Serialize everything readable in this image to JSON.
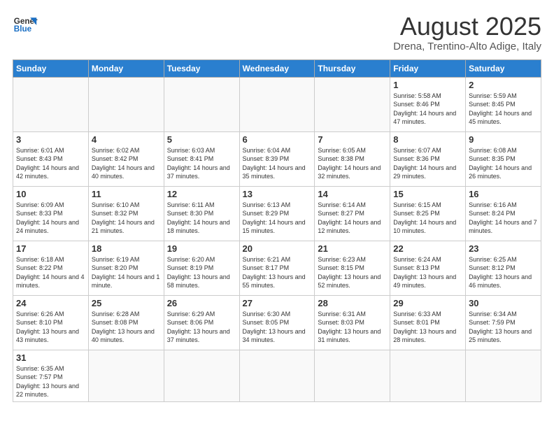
{
  "header": {
    "logo_general": "General",
    "logo_blue": "Blue",
    "month_title": "August 2025",
    "location": "Drena, Trentino-Alto Adige, Italy"
  },
  "weekdays": [
    "Sunday",
    "Monday",
    "Tuesday",
    "Wednesday",
    "Thursday",
    "Friday",
    "Saturday"
  ],
  "weeks": [
    [
      {
        "day": "",
        "info": ""
      },
      {
        "day": "",
        "info": ""
      },
      {
        "day": "",
        "info": ""
      },
      {
        "day": "",
        "info": ""
      },
      {
        "day": "",
        "info": ""
      },
      {
        "day": "1",
        "info": "Sunrise: 5:58 AM\nSunset: 8:46 PM\nDaylight: 14 hours and 47 minutes."
      },
      {
        "day": "2",
        "info": "Sunrise: 5:59 AM\nSunset: 8:45 PM\nDaylight: 14 hours and 45 minutes."
      }
    ],
    [
      {
        "day": "3",
        "info": "Sunrise: 6:01 AM\nSunset: 8:43 PM\nDaylight: 14 hours and 42 minutes."
      },
      {
        "day": "4",
        "info": "Sunrise: 6:02 AM\nSunset: 8:42 PM\nDaylight: 14 hours and 40 minutes."
      },
      {
        "day": "5",
        "info": "Sunrise: 6:03 AM\nSunset: 8:41 PM\nDaylight: 14 hours and 37 minutes."
      },
      {
        "day": "6",
        "info": "Sunrise: 6:04 AM\nSunset: 8:39 PM\nDaylight: 14 hours and 35 minutes."
      },
      {
        "day": "7",
        "info": "Sunrise: 6:05 AM\nSunset: 8:38 PM\nDaylight: 14 hours and 32 minutes."
      },
      {
        "day": "8",
        "info": "Sunrise: 6:07 AM\nSunset: 8:36 PM\nDaylight: 14 hours and 29 minutes."
      },
      {
        "day": "9",
        "info": "Sunrise: 6:08 AM\nSunset: 8:35 PM\nDaylight: 14 hours and 26 minutes."
      }
    ],
    [
      {
        "day": "10",
        "info": "Sunrise: 6:09 AM\nSunset: 8:33 PM\nDaylight: 14 hours and 24 minutes."
      },
      {
        "day": "11",
        "info": "Sunrise: 6:10 AM\nSunset: 8:32 PM\nDaylight: 14 hours and 21 minutes."
      },
      {
        "day": "12",
        "info": "Sunrise: 6:11 AM\nSunset: 8:30 PM\nDaylight: 14 hours and 18 minutes."
      },
      {
        "day": "13",
        "info": "Sunrise: 6:13 AM\nSunset: 8:29 PM\nDaylight: 14 hours and 15 minutes."
      },
      {
        "day": "14",
        "info": "Sunrise: 6:14 AM\nSunset: 8:27 PM\nDaylight: 14 hours and 12 minutes."
      },
      {
        "day": "15",
        "info": "Sunrise: 6:15 AM\nSunset: 8:25 PM\nDaylight: 14 hours and 10 minutes."
      },
      {
        "day": "16",
        "info": "Sunrise: 6:16 AM\nSunset: 8:24 PM\nDaylight: 14 hours and 7 minutes."
      }
    ],
    [
      {
        "day": "17",
        "info": "Sunrise: 6:18 AM\nSunset: 8:22 PM\nDaylight: 14 hours and 4 minutes."
      },
      {
        "day": "18",
        "info": "Sunrise: 6:19 AM\nSunset: 8:20 PM\nDaylight: 14 hours and 1 minute."
      },
      {
        "day": "19",
        "info": "Sunrise: 6:20 AM\nSunset: 8:19 PM\nDaylight: 13 hours and 58 minutes."
      },
      {
        "day": "20",
        "info": "Sunrise: 6:21 AM\nSunset: 8:17 PM\nDaylight: 13 hours and 55 minutes."
      },
      {
        "day": "21",
        "info": "Sunrise: 6:23 AM\nSunset: 8:15 PM\nDaylight: 13 hours and 52 minutes."
      },
      {
        "day": "22",
        "info": "Sunrise: 6:24 AM\nSunset: 8:13 PM\nDaylight: 13 hours and 49 minutes."
      },
      {
        "day": "23",
        "info": "Sunrise: 6:25 AM\nSunset: 8:12 PM\nDaylight: 13 hours and 46 minutes."
      }
    ],
    [
      {
        "day": "24",
        "info": "Sunrise: 6:26 AM\nSunset: 8:10 PM\nDaylight: 13 hours and 43 minutes."
      },
      {
        "day": "25",
        "info": "Sunrise: 6:28 AM\nSunset: 8:08 PM\nDaylight: 13 hours and 40 minutes."
      },
      {
        "day": "26",
        "info": "Sunrise: 6:29 AM\nSunset: 8:06 PM\nDaylight: 13 hours and 37 minutes."
      },
      {
        "day": "27",
        "info": "Sunrise: 6:30 AM\nSunset: 8:05 PM\nDaylight: 13 hours and 34 minutes."
      },
      {
        "day": "28",
        "info": "Sunrise: 6:31 AM\nSunset: 8:03 PM\nDaylight: 13 hours and 31 minutes."
      },
      {
        "day": "29",
        "info": "Sunrise: 6:33 AM\nSunset: 8:01 PM\nDaylight: 13 hours and 28 minutes."
      },
      {
        "day": "30",
        "info": "Sunrise: 6:34 AM\nSunset: 7:59 PM\nDaylight: 13 hours and 25 minutes."
      }
    ],
    [
      {
        "day": "31",
        "info": "Sunrise: 6:35 AM\nSunset: 7:57 PM\nDaylight: 13 hours and 22 minutes."
      },
      {
        "day": "",
        "info": ""
      },
      {
        "day": "",
        "info": ""
      },
      {
        "day": "",
        "info": ""
      },
      {
        "day": "",
        "info": ""
      },
      {
        "day": "",
        "info": ""
      },
      {
        "day": "",
        "info": ""
      }
    ]
  ]
}
